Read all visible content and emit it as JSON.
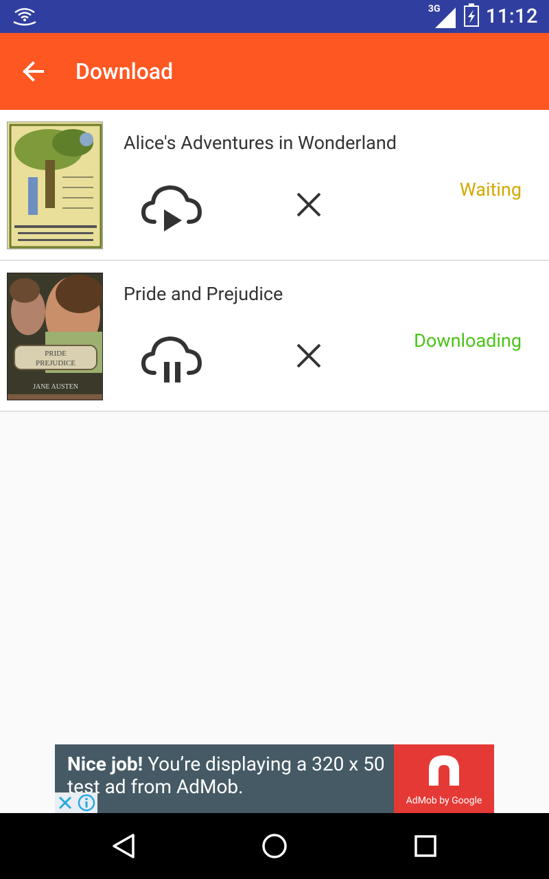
{
  "status_bar": {
    "network": "3G",
    "time": "11:12"
  },
  "app_bar": {
    "title": "Download"
  },
  "downloads": [
    {
      "title": "Alice's Adventures in Wonderland",
      "status": "Waiting",
      "status_color": "#d4a800",
      "action_icon": "cloud-play-icon"
    },
    {
      "title": "Pride and Prejudice",
      "status": "Downloading",
      "status_color": "#4cc417",
      "action_icon": "cloud-pause-icon"
    }
  ],
  "ad": {
    "headline_bold": "Nice job!",
    "headline_rest": " You’re displaying a 320 x 50 test ad from AdMob.",
    "brand": "AdMob by Google"
  },
  "colors": {
    "status_bar": "#303f9f",
    "app_bar": "#ff5722",
    "ad_bg": "#455a64",
    "ad_accent": "#e53935"
  }
}
